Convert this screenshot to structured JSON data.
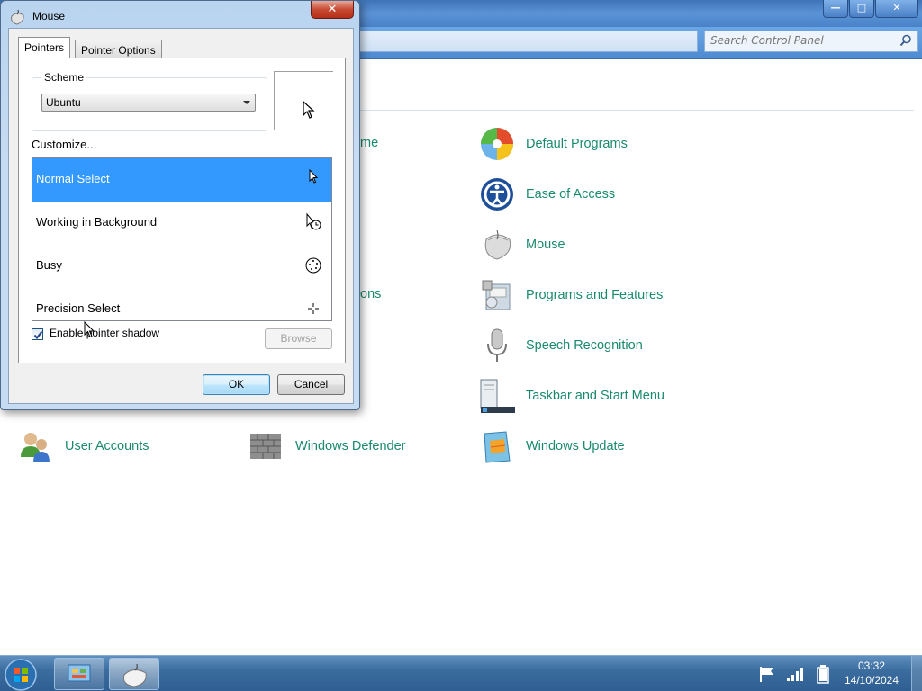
{
  "control_panel": {
    "search_placeholder": "Search Control Panel",
    "partial_labels": {
      "a": "me",
      "b": "ons"
    },
    "items": [
      {
        "label": "Default Programs",
        "icon": "default-programs-icon"
      },
      {
        "label": "Ease of Access",
        "icon": "ease-of-access-icon"
      },
      {
        "label": "Mouse",
        "icon": "mouse-icon"
      },
      {
        "label": "Programs and Features",
        "icon": "programs-features-icon"
      },
      {
        "label": "Speech Recognition",
        "icon": "microphone-icon"
      },
      {
        "label": "Taskbar and Start Menu",
        "icon": "taskbar-icon"
      },
      {
        "label": "User Accounts",
        "icon": "users-icon"
      },
      {
        "label": "Windows Defender",
        "icon": "defender-wall-icon"
      },
      {
        "label": "Windows Update",
        "icon": "windows-update-icon"
      }
    ],
    "link_color": "#1a8a6e"
  },
  "dialog": {
    "title": "Mouse",
    "close_glyph": "✕",
    "tabs": [
      "Pointers",
      "Pointer Options"
    ],
    "scheme_legend": "Scheme",
    "scheme_value": "Ubuntu",
    "customize_label": "Customize...",
    "cursors": [
      {
        "label": "Normal Select",
        "selected": true,
        "icon": "arrow-cursor-icon"
      },
      {
        "label": "Working in Background",
        "selected": false,
        "icon": "working-cursor-icon"
      },
      {
        "label": "Busy",
        "selected": false,
        "icon": "busy-cursor-icon"
      },
      {
        "label": "Precision Select",
        "selected": false,
        "icon": "crosshair-cursor-icon"
      }
    ],
    "shadow_label": "Enable pointer shadow",
    "shadow_checked": true,
    "browse_label": "Browse",
    "ok_label": "OK",
    "cancel_label": "Cancel",
    "selection_color": "#3399ff"
  },
  "taskbar": {
    "time": "03:32",
    "date": "14/10/2024"
  }
}
